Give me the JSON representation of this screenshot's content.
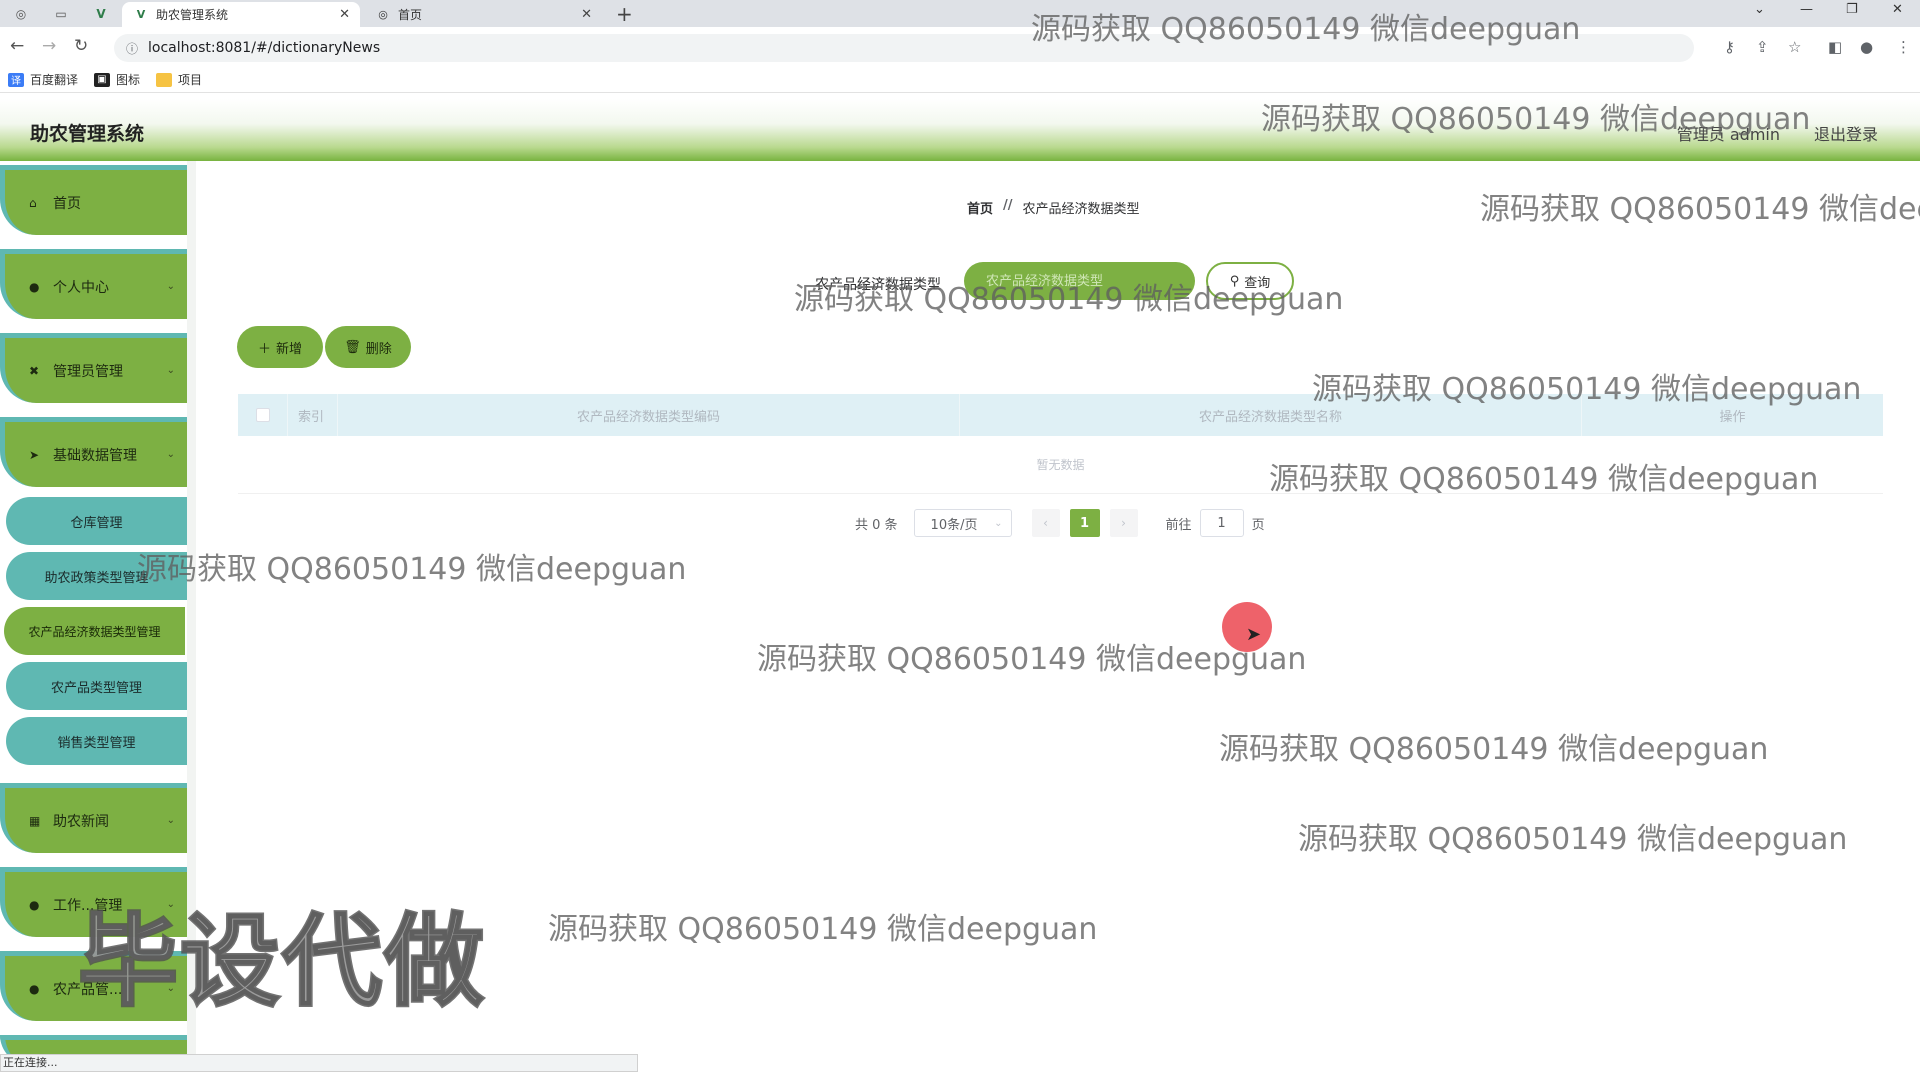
{
  "browser": {
    "tabs": [
      {
        "title": "助农管理系统",
        "active": true
      },
      {
        "title": "首页",
        "active": false
      }
    ],
    "url": "localhost:8081/#/dictionaryNews",
    "bookmarks": [
      "百度翻译",
      "图标",
      "项目"
    ],
    "status_text": "正在连接..."
  },
  "header": {
    "title": "助农管理系统",
    "admin_label": "管理员 admin",
    "logout_label": "退出登录"
  },
  "sidebar": {
    "items": [
      {
        "label": "首页",
        "icon": "home-icon",
        "has_children": false
      },
      {
        "label": "个人中心",
        "icon": "user-icon",
        "has_children": true
      },
      {
        "label": "管理员管理",
        "icon": "admin-icon",
        "has_children": true
      },
      {
        "label": "基础数据管理",
        "icon": "send-icon",
        "has_children": true
      }
    ],
    "sub_items": [
      {
        "label": "仓库管理",
        "active": false
      },
      {
        "label": "助农政策类型管理",
        "active": false
      },
      {
        "label": "农产品经济数据类型管理",
        "active": true
      },
      {
        "label": "农产品类型管理",
        "active": false
      },
      {
        "label": "销售类型管理",
        "active": false
      }
    ],
    "items_bottom": [
      {
        "label": "助农新闻",
        "icon": "grid-icon",
        "has_children": true
      },
      {
        "label": "工作...管理",
        "icon": "pin-icon",
        "has_children": true
      },
      {
        "label": "农产品管...",
        "icon": "user-icon",
        "has_children": true
      }
    ]
  },
  "breadcrumb": {
    "home": "首页",
    "separator": "//",
    "current": "农产品经济数据类型"
  },
  "search": {
    "label": "农产品经济数据类型",
    "placeholder": "农产品经济数据类型",
    "button_label": "查询"
  },
  "actions": {
    "add_label": "新增",
    "delete_label": "删除"
  },
  "table": {
    "columns": [
      "索引",
      "农产品经济数据类型编码",
      "农产品经济数据类型名称",
      "操作"
    ],
    "rows": [],
    "empty_text": "暂无数据"
  },
  "pagination": {
    "total_text": "共 0 条",
    "page_size": "10条/页",
    "current_page": "1",
    "goto_label": "前往",
    "goto_value": "1",
    "page_suffix": "页"
  },
  "watermark": {
    "text": "源码获取 QQ86050149 微信deepguan",
    "big_text": "毕设代做"
  },
  "colors": {
    "primary_green": "#7db043",
    "teal": "#5fb8b2",
    "table_header": "#dff0f5",
    "cursor_highlight": "#eb4650"
  }
}
